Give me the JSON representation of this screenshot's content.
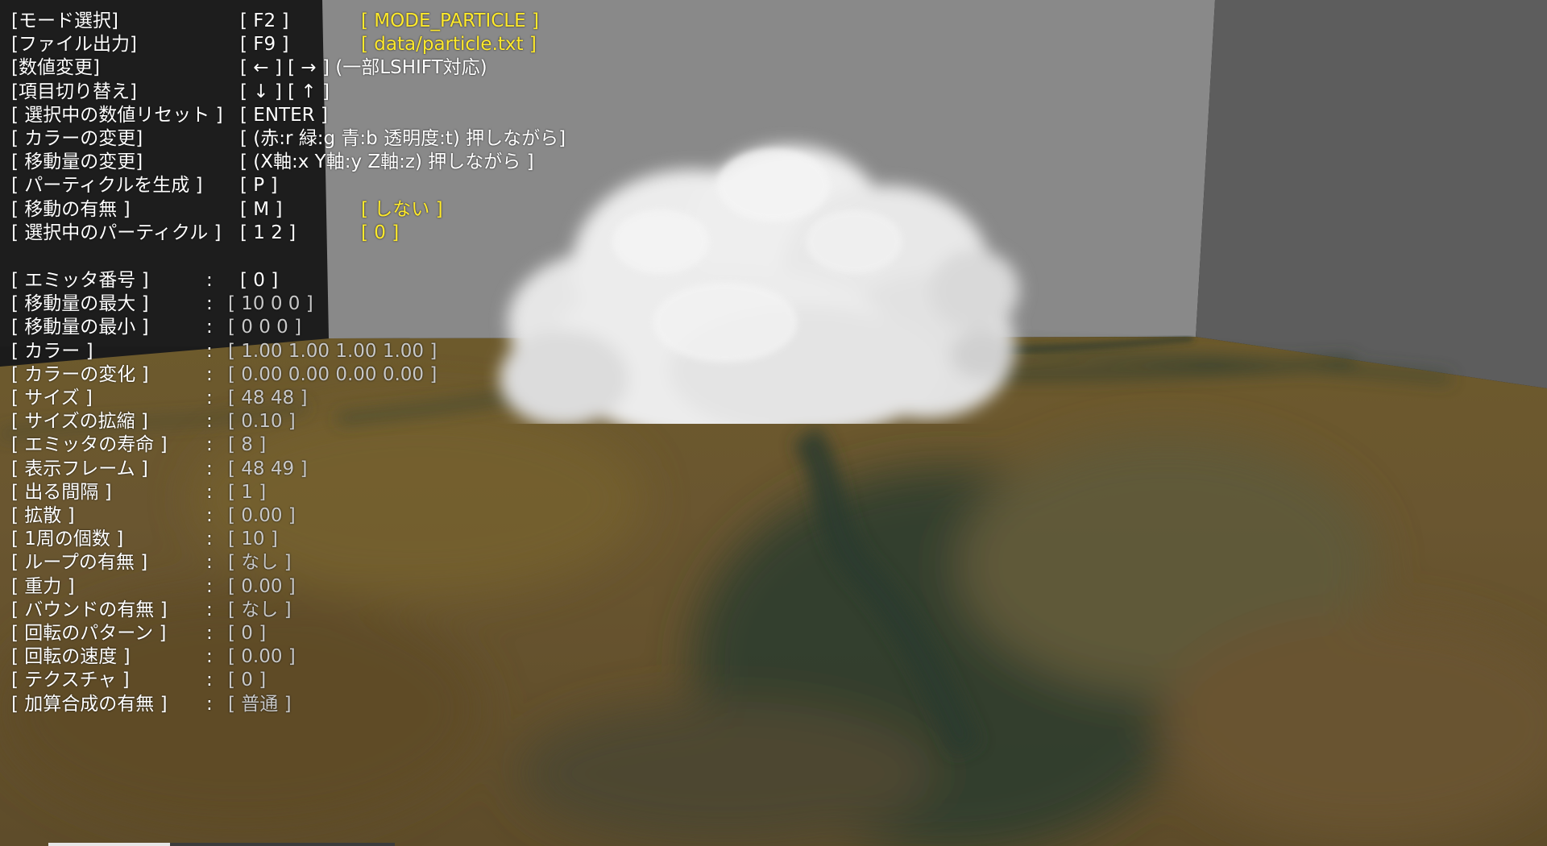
{
  "window": {
    "title": ""
  },
  "colors": {
    "hud_white": "#ffffff",
    "hud_yellow": "#ffea2b",
    "hud_gray": "#c8c8c8",
    "wall": "#888888",
    "side_wall": "#5c5c5c",
    "floor": "#6f5a2c",
    "floor_crack": "#2f3d2c",
    "smoke": "#e8e8e8"
  },
  "controls": [
    {
      "label": "[モード選択]",
      "key": "[ F2 ]",
      "value": "[ MODE_PARTICLE ]"
    },
    {
      "label": "[ファイル出力]",
      "key": "[ F9 ]",
      "value": "[ data/particle.txt ]"
    },
    {
      "label": "[数値変更]",
      "key": "[ ← ] [ → ] (一部LSHIFT対応)",
      "value": ""
    },
    {
      "label": "[項目切り替え]",
      "key": "[ ↓ ] [ ↑ ]",
      "value": ""
    },
    {
      "label": "[ 選択中の数値リセット ]",
      "key": "[ ENTER ]",
      "value": ""
    },
    {
      "label": "[ カラーの変更]",
      "key": "[ (赤:r 緑:g 青:b 透明度:t) 押しながら]",
      "value": ""
    },
    {
      "label": "[ 移動量の変更]",
      "key": "[ (X軸:x Y軸:y Z軸:z) 押しながら ]",
      "value": ""
    },
    {
      "label": "[ パーティクルを生成 ]",
      "key": "[ P ]",
      "value": ""
    },
    {
      "label": "[ 移動の有無 ]",
      "key": "[ M ]",
      "value": "[ しない ]"
    },
    {
      "label": "[ 選択中のパーティクル ]",
      "key": "[ 1 2 ]",
      "value": "[ 0 ]"
    }
  ],
  "params": [
    {
      "label": "[ エミッタ番号 ]",
      "colon": ":",
      "value": "[ 0 ]",
      "bright": true
    },
    {
      "label": "[ 移動量の最大 ]",
      "colon": ":",
      "value": "[ 10 0 0 ]"
    },
    {
      "label": "[ 移動量の最小 ]",
      "colon": ":",
      "value": "[ 0 0 0 ]"
    },
    {
      "label": "[ カラー ]",
      "colon": ":",
      "value": "[ 1.00 1.00 1.00 1.00 ]"
    },
    {
      "label": "[ カラーの変化 ]",
      "colon": ":",
      "value": "[ 0.00 0.00 0.00 0.00 ]"
    },
    {
      "label": "[ サイズ ]",
      "colon": ":",
      "value": "[ 48 48 ]"
    },
    {
      "label": "[ サイズの拡縮 ]",
      "colon": ":",
      "value": "[ 0.10 ]"
    },
    {
      "label": "[ エミッタの寿命 ]",
      "colon": ":",
      "value": "[ 8 ]"
    },
    {
      "label": "[ 表示フレーム ]",
      "colon": ":",
      "value": "[ 48 49 ]"
    },
    {
      "label": "[ 出る間隔 ]",
      "colon": ":",
      "value": "[ 1 ]"
    },
    {
      "label": "[ 拡散 ]",
      "colon": ":",
      "value": "[ 0.00 ]"
    },
    {
      "label": "[ 1周の個数 ]",
      "colon": ":",
      "value": "[ 10 ]"
    },
    {
      "label": "[ ループの有無 ]",
      "colon": ":",
      "value": "[ なし ]"
    },
    {
      "label": "[ 重力 ]",
      "colon": ":",
      "value": "[ 0.00 ]"
    },
    {
      "label": "[ バウンドの有無 ]",
      "colon": ":",
      "value": "[ なし ]"
    },
    {
      "label": "[ 回転のパターン ]",
      "colon": ":",
      "value": "[ 0 ]"
    },
    {
      "label": "[ 回転の速度 ]",
      "colon": ":",
      "value": "[ 0.00 ]"
    },
    {
      "label": "[ テクスチャ ]",
      "colon": ":",
      "value": "[ 0 ]"
    },
    {
      "label": "[ 加算合成の有無 ]",
      "colon": ":",
      "value": "[ 普通 ]"
    }
  ],
  "progress": {
    "fraction": 0.35
  }
}
